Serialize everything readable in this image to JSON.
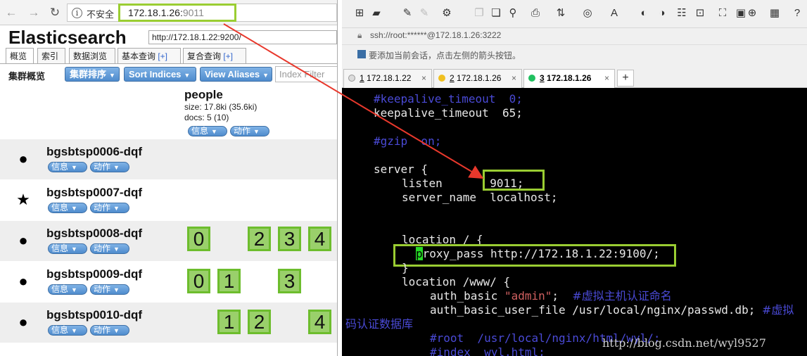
{
  "browser": {
    "insecure_label": "不安全",
    "url_host": "172.18.1.26:",
    "url_port": "9011"
  },
  "es_head": {
    "title": "Elasticsearch",
    "connect_url": "http://172.18.1.22:9200/",
    "tabs": [
      {
        "label": "概览",
        "plus": ""
      },
      {
        "label": "索引",
        "plus": ""
      },
      {
        "label": "数据浏览",
        "plus": ""
      },
      {
        "label": "基本查询 ",
        "plus": "[+]"
      },
      {
        "label": "复合查询 ",
        "plus": "[+]"
      }
    ],
    "overview_label": "集群概览",
    "toolbar": {
      "sort_cluster": "集群排序",
      "sort_indices": "Sort Indices",
      "view_aliases": "View Aliases",
      "index_filter_placeholder": "Index Filter"
    },
    "index": {
      "name": "people",
      "size": "size: 17.8ki (35.6ki)",
      "docs": "docs: 5 (10)",
      "info_label": "信息",
      "action_label": "动作"
    },
    "nodes": [
      {
        "name": "bgsbtsp0006-dqf",
        "marker": "circle",
        "shards": []
      },
      {
        "name": "bgsbtsp0007-dqf",
        "marker": "star",
        "shards": []
      },
      {
        "name": "bgsbtsp0008-dqf",
        "marker": "circle",
        "shards": [
          "0",
          "2",
          "3",
          "4"
        ]
      },
      {
        "name": "bgsbtsp0009-dqf",
        "marker": "circle",
        "shards": [
          "0",
          "1",
          "3"
        ]
      },
      {
        "name": "bgsbtsp0010-dqf",
        "marker": "circle",
        "shards": [
          "1",
          "2",
          "4"
        ]
      }
    ]
  },
  "xshell": {
    "ssh_url": "ssh://root:******@172.18.1.26:3222",
    "hint": "要添加当前会话，点击左侧的箭头按钮。",
    "tabs": [
      {
        "num": "1",
        "label": " 172.18.1.22",
        "status_color": "#e0e0e0"
      },
      {
        "num": "2",
        "label": " 172.18.1.26",
        "status_color": "#f0c020"
      },
      {
        "num": "3",
        "label": " 172.18.1.26",
        "status_color": "#20c060"
      }
    ],
    "terminal": {
      "line1": "#keepalive_timeout  0;",
      "line2": "keepalive_timeout  65;",
      "line3": "#gzip  on;",
      "line4": "server {",
      "line5a": "listen       ",
      "line5b": "9011;",
      "line6": "server_name  localhost;",
      "line7": "location / {",
      "line8_cursor": "p",
      "line8": "roxy_pass http://172.18.1.22:9100/;",
      "line9": "}",
      "line10": "location /www/ {",
      "line11a": "auth_basic ",
      "line11b": "\"admin\"",
      "line11c": ";  ",
      "line11d": "#虚拟主机认证命名",
      "line12a": "auth_basic_user_file /usr/local/nginx/passwd.db; ",
      "line12b": "#虚拟",
      "line13": "码认证数据库",
      "line14": "#root  /usr/local/nginx/html/wyl/;",
      "line15": "#index  wyl.html;"
    },
    "watermark": "http://blog.csdn.net/wyl9527"
  },
  "colors": {
    "highlight_box": "#9acd32",
    "arrow": "#e8382c",
    "shard_fill": "#9ad06b",
    "button_blue": "#4f8ccd"
  }
}
